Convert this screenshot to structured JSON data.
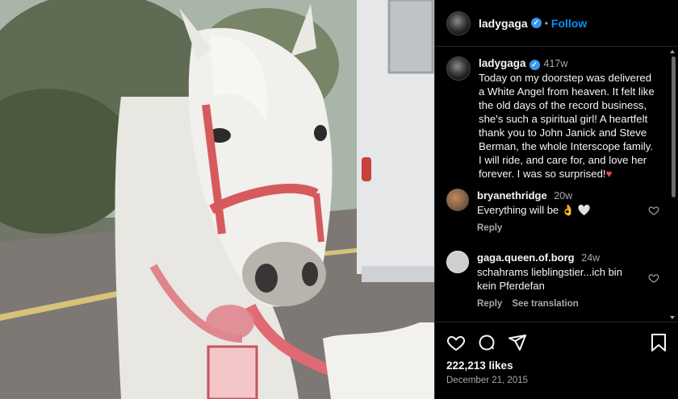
{
  "post": {
    "username": "ladygaga",
    "follow_label": "Follow",
    "dot": "•",
    "verified_mark": "✓",
    "caption_age": "417w",
    "caption": "Today on my doorstep was delivered a White Angel from heaven. It felt like the old days of the record business, she's such a spiritual girl! A heartfelt thank you to John Janick and Steve Berman, the whole Interscope family. I will ride, and care for, and love her forever. I was so surprised!",
    "caption_emoji": "♥",
    "image_alt": "White horse with red halter",
    "likes": "222,213 likes",
    "date": "December 21, 2015"
  },
  "comments": [
    {
      "username": "bryanethridge",
      "age": "20w",
      "text": "Everything will be 👌 🤍",
      "reply_label": "Reply",
      "translation_label": "",
      "avatar_color": "#7a5a40"
    },
    {
      "username": "gaga.queen.of.borg",
      "age": "24w",
      "text": "schahrams lieblingstier...ich bin kein Pferdefan",
      "reply_label": "Reply",
      "translation_label": "See translation",
      "avatar_color": "#cfcfcf"
    }
  ],
  "icons": {
    "like": "heart-icon",
    "comment": "comment-icon",
    "share": "share-icon",
    "save": "bookmark-icon"
  },
  "colors": {
    "accent": "#0095f6",
    "background": "#000000",
    "muted": "#a8a8a8",
    "heart": "#ed4956"
  }
}
